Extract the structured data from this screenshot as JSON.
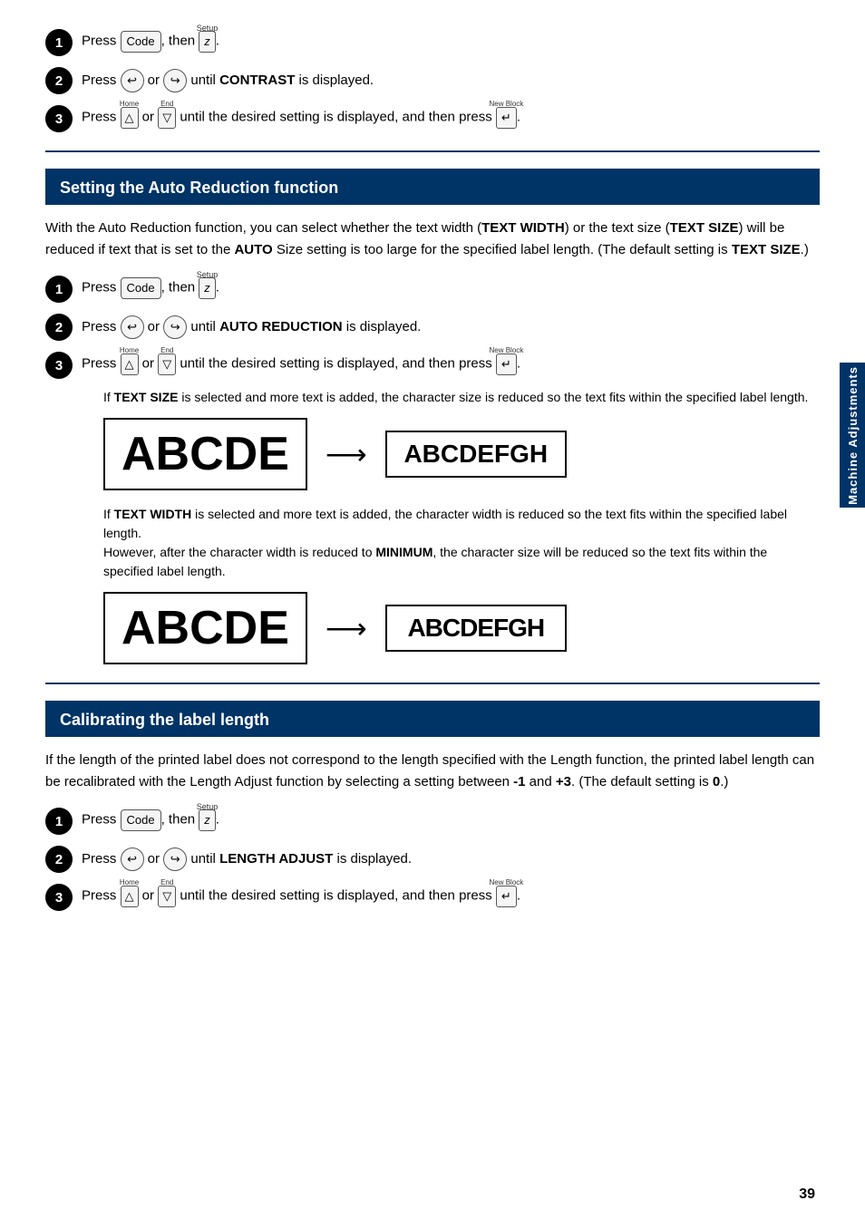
{
  "page": {
    "number": "39",
    "side_tab": "Machine Adjustments"
  },
  "section0": {
    "steps": [
      {
        "num": "1",
        "html": "Press <code>Code</code>, then <kbd>z</kbd> (Setup)."
      },
      {
        "num": "2",
        "html": "Press ← or → until <strong>CONTRAST</strong> is displayed."
      },
      {
        "num": "3",
        "html": "Press ↑ (Home) or ↓ (End) until the desired setting is displayed, and then press ↵ (New Block)."
      }
    ]
  },
  "section1": {
    "title": "Setting the Auto Reduction function",
    "body": "With the Auto Reduction function, you can select whether the text width (TEXT WIDTH) or the text size (TEXT SIZE) will be reduced if text that is set to the AUTO Size setting is too large for the specified label length. (The default setting is TEXT SIZE.)",
    "steps": [
      {
        "num": "1",
        "text": "Press Code, then z (Setup)."
      },
      {
        "num": "2",
        "text": "Press ← or → until AUTO REDUCTION is displayed."
      },
      {
        "num": "3",
        "text": "Press ↑ (Home) or ↓ (End) until the desired setting is displayed, and then press ↵ (New Block)."
      }
    ],
    "sub1": "If TEXT SIZE is selected and more text is added, the character size is reduced so the text fits within the specified label length.",
    "diagram1_from": "ABCDE",
    "diagram1_to": "ABCDEFGH",
    "sub2_line1": "If TEXT WIDTH is selected and more text is added, the character width is reduced so the text fits within the specified label length.",
    "sub2_line2": "However, after the character width is reduced to MINIMUM, the character size will be reduced so the text fits within the specified label length.",
    "diagram2_from": "ABCDE",
    "diagram2_to": "ABCDEFGH"
  },
  "section2": {
    "title": "Calibrating the label length",
    "body": "If the length of the printed label does not correspond to the length specified with the Length function, the printed label length can be recalibrated with the Length Adjust function by selecting a setting between -1 and +3. (The default setting is 0.)",
    "steps": [
      {
        "num": "1",
        "text": "Press Code, then z (Setup)."
      },
      {
        "num": "2",
        "text": "Press ← or → until LENGTH ADJUST is displayed."
      },
      {
        "num": "3",
        "text": "Press ↑ (Home) or ↓ (End) until the desired setting is displayed, and then press ↵ (New Block)."
      }
    ]
  }
}
